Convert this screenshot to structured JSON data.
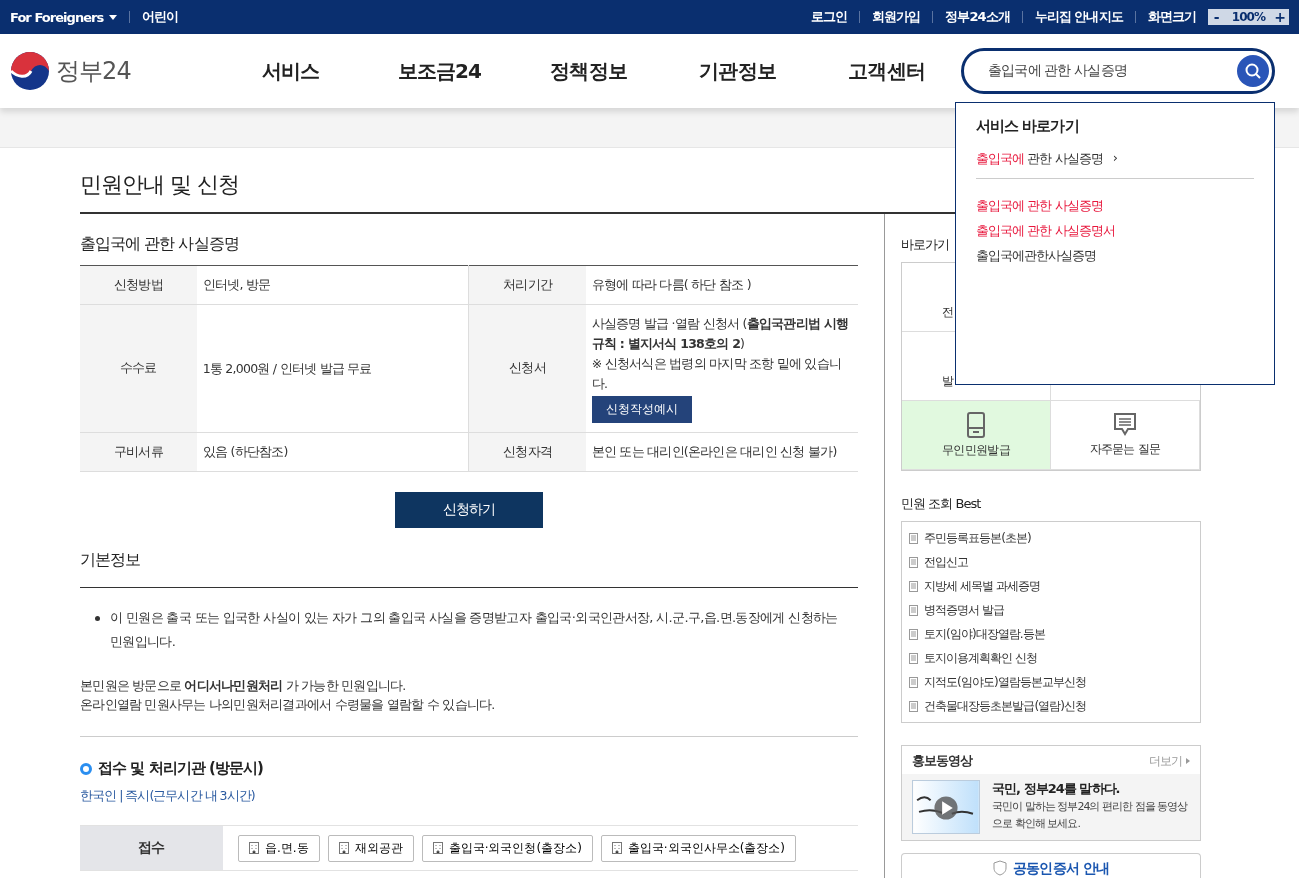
{
  "top_bar": {
    "left": [
      {
        "label": "For Foreigners",
        "kind": "dropdown"
      },
      {
        "label": "어린이",
        "kind": "link"
      }
    ],
    "right": [
      "로그인",
      "회원가입",
      "정부24소개",
      "누리집 안내지도"
    ],
    "zoom": {
      "label": "화면크기",
      "minus": "-",
      "value": "100%",
      "plus": "+"
    }
  },
  "header": {
    "logo": "정부24",
    "nav": [
      "서비스",
      "보조금24",
      "정책정보",
      "기관정보",
      "고객센터"
    ],
    "search": {
      "value": "출입국에 관한 사실증명"
    }
  },
  "search_dropdown": {
    "title": "서비스 바로가기",
    "shortcut": {
      "match": "출입국에",
      "rest": " 관한 사실증명",
      "arrow": "›"
    },
    "suggestions": [
      {
        "text": "출입국에 관한 사실증명",
        "highlighted": true
      },
      {
        "text": "출입국에 관한 사실증명서",
        "highlighted": true
      },
      {
        "text": "출입국에관한사실증명",
        "highlighted": false
      }
    ]
  },
  "page_title": "민원안내 및 신청",
  "main": {
    "service_title": "출입국에 관한 사실증명",
    "info_table": [
      [
        {
          "label": "신청방법",
          "value": "인터넷, 방문"
        },
        {
          "label": "처리기간",
          "value": "유형에 따라 다름( 하단 참조 )"
        }
      ],
      [
        {
          "label": "수수료",
          "value": "1통 2,000원 / 인터넷 발급 무료"
        },
        {
          "label": "신청서",
          "value": "사실증명 발급 ·열람 신청서 (**출입국관리법 시행규칙 : 별지서식 138호의 2**)",
          "note": "※ 신청서식은 법령의 마지막 조항 밑에 있습니다.",
          "button": "신청작성예시"
        }
      ],
      [
        {
          "label": "구비서류",
          "value": "있음 (하단참조)"
        },
        {
          "label": "신청자격",
          "value": "본인 또는 대리인(온라인은 대리인 신청 불가)"
        }
      ]
    ],
    "apply_button": "신청하기",
    "basic_info": {
      "title": "기본정보",
      "bullet": "이 민원은 출국 또는 입국한 사실이 있는 자가 그의 출입국 사실을 증명받고자 출입국·외국인관서장, 시.군.구,읍.면.동장에게 신청하는 민원입니다.",
      "notes": [
        "본민원은 방문으로 **어디서나민원처리** 가 가능한 민원입니다.",
        "온라인열람 민원사무는 나의민원처리결과에서 수령물을 열람할 수 있습니다."
      ]
    },
    "agency": {
      "title": "접수 및 처리기관 (방문시)",
      "subtitle": "한국인 | 즉시(근무시간 내 3시간)",
      "rows": [
        {
          "label": "접수",
          "places": [
            "읍.면.동",
            "재외공관",
            "출입국·외국인청(출장소)",
            "출입국·외국인사무소(출장소)"
          ]
        }
      ]
    }
  },
  "sidebar": {
    "quick_title": "바로가기",
    "quick_links": [
      {
        "kind": "covered",
        "label": "전"
      },
      {
        "kind": "blank"
      },
      {
        "kind": "covered",
        "label": "발"
      },
      {
        "kind": "blank"
      },
      {
        "kind": "kiosk",
        "label": "무인민원발급",
        "highlighted": true
      },
      {
        "kind": "faq",
        "label": "자주묻는 질문",
        "highlighted": false
      }
    ],
    "best_title": "민원 조회 Best",
    "best": [
      "주민등록표등본(초본)",
      "전입신고",
      "지방세 세목별 과세증명",
      "병적증명서 발급",
      "토지(임야)대장열람.등본",
      "토지이용계획확인 신청",
      "지적도(임야도)열람등본교부신청",
      "건축물대장등초본발급(열람)신청"
    ],
    "video": {
      "title": "홍보동영상",
      "more": "더보기",
      "headline": "국민, 정부24를 말하다.",
      "text": "국민이 말하는 정부24의 편리한 점을 동영상으로 확인해 보세요.",
      "kind": "picture"
    },
    "cert": "공동인증서 안내"
  }
}
